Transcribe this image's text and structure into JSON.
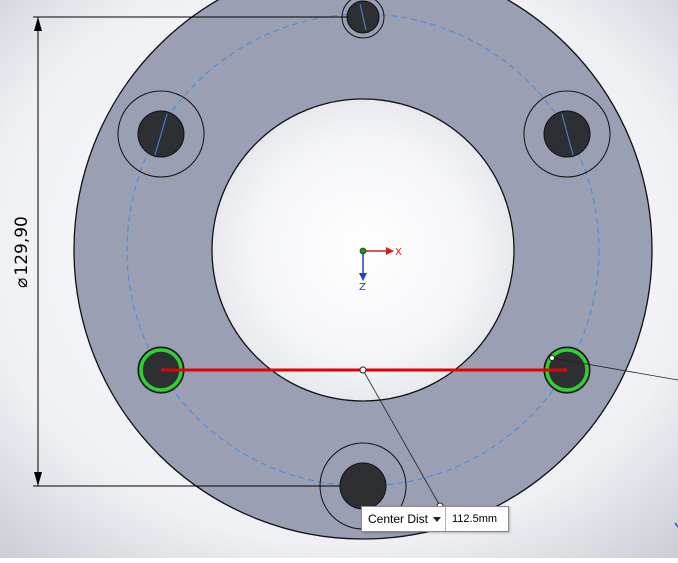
{
  "dimension": {
    "diameter_symbol": "⌀",
    "value": "129,90"
  },
  "triad": {
    "x_label": "X",
    "z_label": "Z"
  },
  "measure_tooltip": {
    "type_label": "Center Dist",
    "value": "112.5mm"
  },
  "colors": {
    "part_face": "#9a9fb4",
    "hole_fill": "#2e2f33",
    "construction_line": "#4a8ad8",
    "measure_line": "#e80000",
    "selection_highlight": "#2fd02f",
    "x_axis": "#d02020",
    "z_axis": "#2040c0"
  }
}
